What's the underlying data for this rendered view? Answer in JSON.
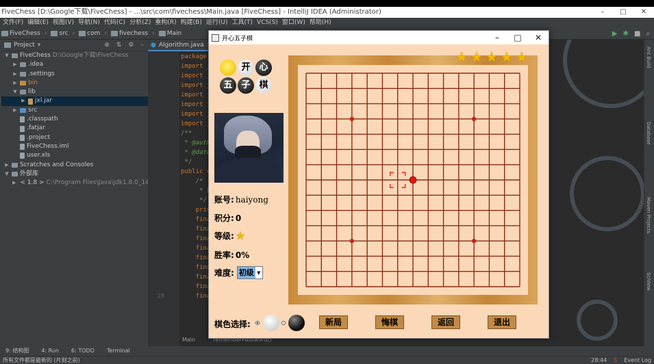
{
  "ide": {
    "window_title": "FiveChess [D:\\Google下载\\FiveChess] - ...\\src\\com\\fivechess\\Main.java [FiveChess] - IntelliJ IDEA (Administrator)",
    "menu": [
      "文件(F)",
      "编辑(E)",
      "视图(V)",
      "导航(N)",
      "代码(C)",
      "分析(Z)",
      "重构(R)",
      "构建(B)",
      "运行(U)",
      "工具(T)",
      "VCS(S)",
      "窗口(W)",
      "帮助(H)"
    ],
    "breadcrumb": [
      "FiveChess",
      "src",
      "com",
      "fivechess",
      "Main"
    ],
    "project_label": "Project",
    "editor_tab": "Algorithm.java",
    "tree": [
      {
        "label": "FiveChess",
        "extra": "D:\\Google下载\\FiveChess",
        "indent": 0,
        "arrow": "▼",
        "icon": "folder"
      },
      {
        "label": ".idea",
        "indent": 1,
        "arrow": "▶",
        "icon": "folder"
      },
      {
        "label": ".settings",
        "indent": 1,
        "arrow": "▶",
        "icon": "folder"
      },
      {
        "label": "bin",
        "indent": 1,
        "arrow": "▶",
        "icon": "folder-orange",
        "orange": true
      },
      {
        "label": "lib",
        "indent": 1,
        "arrow": "▼",
        "icon": "folder"
      },
      {
        "label": "jxl.jar",
        "indent": 2,
        "arrow": "▶",
        "icon": "jar",
        "selected": true
      },
      {
        "label": "src",
        "indent": 1,
        "arrow": "▶",
        "icon": "folder-blue"
      },
      {
        "label": ".classpath",
        "indent": 1,
        "arrow": "",
        "icon": "file"
      },
      {
        "label": ".fatjar",
        "indent": 1,
        "arrow": "",
        "icon": "file"
      },
      {
        "label": ".project",
        "indent": 1,
        "arrow": "",
        "icon": "file"
      },
      {
        "label": "FiveChess.iml",
        "indent": 1,
        "arrow": "",
        "icon": "file"
      },
      {
        "label": "user.xls",
        "indent": 1,
        "arrow": "",
        "icon": "file"
      },
      {
        "label": "Scratches and Consoles",
        "indent": 0,
        "arrow": "▶",
        "icon": "folder"
      },
      {
        "label": "外部库",
        "indent": 0,
        "arrow": "▼",
        "icon": "folder"
      },
      {
        "label": "< 1.8 >",
        "extra": "C:\\Program Files\\Java\\jdk1.8.0_144",
        "indent": 1,
        "arrow": "▶",
        "icon": "folder"
      }
    ],
    "code_lines": [
      {
        "kind": "kw",
        "text": "package c"
      },
      {
        "kind": "kw",
        "text": "import ja"
      },
      {
        "kind": "kw",
        "text": "import ja"
      },
      {
        "kind": "kw",
        "text": "import ja"
      },
      {
        "kind": "kw",
        "text": "import ja"
      },
      {
        "kind": "kw",
        "text": "import ja"
      },
      {
        "kind": "kw",
        "text": "import ja"
      },
      {
        "kind": "kw",
        "text": "import ja"
      },
      {
        "kind": "gray",
        "text": "/**"
      },
      {
        "kind": "cm",
        "text": " * @auth"
      },
      {
        "kind": "cm",
        "text": " * @date"
      },
      {
        "kind": "gray",
        "text": " */"
      },
      {
        "kind": "kw",
        "text": "public c"
      },
      {
        "kind": "gray",
        "text": "    /*"
      },
      {
        "kind": "gray",
        "text": "     * 用"
      },
      {
        "kind": "gray",
        "text": "     */"
      },
      {
        "kind": "kw",
        "text": "    priv"
      },
      {
        "kind": "plain",
        "text": ""
      },
      {
        "kind": "kw",
        "text": "    fina"
      },
      {
        "kind": "kw",
        "text": "    fina"
      },
      {
        "kind": "kw",
        "text": "    fina"
      },
      {
        "kind": "kw",
        "text": "    fina"
      },
      {
        "kind": "kw",
        "text": "    fina"
      },
      {
        "kind": "kw",
        "text": "    fina"
      },
      {
        "kind": "kw",
        "text": "    fina"
      },
      {
        "kind": "kw",
        "text": "    fina"
      },
      {
        "kind": "kw",
        "text": "    fina"
      }
    ],
    "line_numbers": [
      "",
      "",
      "",
      "",
      "",
      "",
      "",
      "",
      "",
      "",
      "",
      "",
      "",
      "",
      "",
      "",
      "",
      "",
      "",
      "",
      "",
      "",
      "",
      "",
      "",
      "28",
      ""
    ],
    "editor_crumbs": [
      "Main",
      "rememberPassword()"
    ],
    "bottom_tabs": [
      "Terminal",
      "6: TODO",
      "4: Run",
      "9: 结构图"
    ],
    "status_text": "所有文件都是最新的 (片刻之前)",
    "status_time": "28:44",
    "event_log": "Event Log",
    "right_tools": [
      "Ant Build",
      "Database",
      "Maven Projects",
      "SciView"
    ]
  },
  "game": {
    "title": "开心五子棋",
    "logo_chars": [
      "开",
      "心",
      "五",
      "子",
      "棋"
    ],
    "account_label": "账号:",
    "account_value": "haiyong",
    "score_label": "积分:",
    "score_value": "0",
    "level_label": "等级:",
    "level_stars": 1,
    "winrate_label": "胜率:",
    "winrate_value": "0%",
    "difficulty_label": "难度:",
    "difficulty_value": "初级",
    "color_label": "棋色选择:",
    "selected_color": "white",
    "buttons": {
      "new": "新局",
      "undo": "悔棋",
      "back": "返回",
      "exit": "退出"
    },
    "rank_stars": 5,
    "board": {
      "size": 15,
      "star_points": [
        [
          3,
          3
        ],
        [
          11,
          3
        ],
        [
          3,
          11
        ],
        [
          11,
          11
        ]
      ],
      "red_stone": [
        7,
        7
      ],
      "last_move_marker": [
        6,
        7
      ]
    },
    "colors": {
      "board_bg": "#fbd8b8",
      "grid_line": "#8b2d18",
      "frame_wood": "#c98a3a",
      "button_bg": "#c28a46",
      "star": "#f2b705",
      "marker": "#e2231a"
    }
  }
}
